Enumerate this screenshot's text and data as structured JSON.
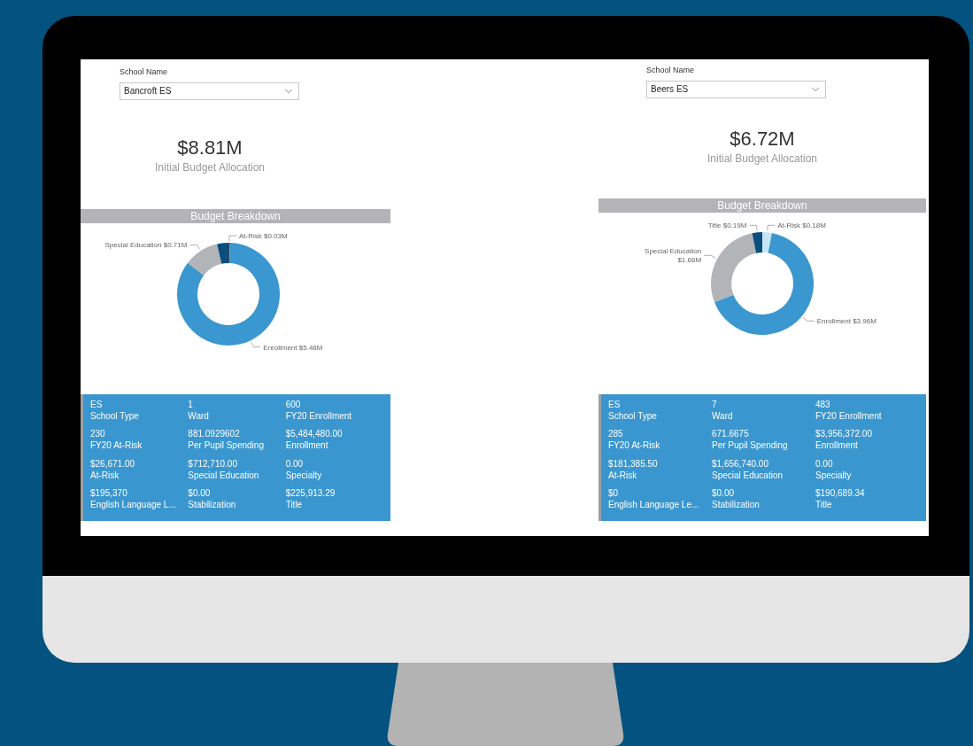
{
  "panels": [
    {
      "filter": {
        "label": "School Name",
        "value": "Bancroft ES"
      },
      "kpi": {
        "value": "$8.81M",
        "label": "Initial Budget Allocation"
      },
      "chart_title": "Budget Breakdown",
      "chart_data": {
        "type": "donut",
        "categories": [
          "At-Risk",
          "Enrollment",
          "Special Education",
          null
        ],
        "values": [
          0.03,
          5.48,
          0.71,
          0.23
        ],
        "colors": [
          "#3a4750",
          "#3a97cf",
          "#b1b5b8",
          "#0a4e7e"
        ],
        "value_labels": [
          "$0.03M",
          "$5.48M",
          "$0.71M",
          null
        ]
      },
      "card": [
        {
          "value": "ES",
          "label": "School Type"
        },
        {
          "value": "1",
          "label": "Ward"
        },
        {
          "value": "600",
          "label": "FY20 Enrollment"
        },
        {
          "value": "230",
          "label": "FY20 At-Risk"
        },
        {
          "value": "881.0929602",
          "label": "Per Pupil Spending"
        },
        {
          "value": "$5,484,480.00",
          "label": "Enrollment"
        },
        {
          "value": "$26,671.00",
          "label": "At-Risk"
        },
        {
          "value": "$712,710.00",
          "label": "Special Education"
        },
        {
          "value": "0.00",
          "label": "Specialty"
        },
        {
          "value": "$195,370",
          "label": "English Language L..."
        },
        {
          "value": "$0.00",
          "label": "Stabilization"
        },
        {
          "value": "$225,913.29",
          "label": "Title"
        }
      ]
    },
    {
      "filter": {
        "label": "School Name",
        "value": "Beers ES"
      },
      "kpi": {
        "value": "$6.72M",
        "label": "Initial Budget Allocation"
      },
      "chart_title": "Budget Breakdown",
      "chart_data": {
        "type": "donut",
        "categories": [
          "At-Risk",
          "Enrollment",
          "Special Education",
          "Title"
        ],
        "values": [
          0.18,
          3.96,
          1.66,
          0.19
        ],
        "colors": [
          "#c6e6f5",
          "#3a97cf",
          "#b1b5b8",
          "#0a4e7e"
        ],
        "value_labels": [
          "$0.18M",
          "$3.96M",
          "$1.66M",
          "$0.19M"
        ]
      },
      "card": [
        {
          "value": "ES",
          "label": "School Type"
        },
        {
          "value": "7",
          "label": "Ward"
        },
        {
          "value": "483",
          "label": "FY20 Enrollment"
        },
        {
          "value": "285",
          "label": "FY20 At-Risk"
        },
        {
          "value": "671.6675",
          "label": "Per Pupil Spending"
        },
        {
          "value": "$3,956,372.00",
          "label": "Enrollment"
        },
        {
          "value": "$181,385.50",
          "label": "At-Risk"
        },
        {
          "value": "$1,656,740.00",
          "label": "Special Education"
        },
        {
          "value": "0.00",
          "label": "Specialty"
        },
        {
          "value": "$0",
          "label": "English Language Le..."
        },
        {
          "value": "$0.00",
          "label": "Stabilization"
        },
        {
          "value": "$190,689.34",
          "label": "Title"
        }
      ]
    }
  ]
}
